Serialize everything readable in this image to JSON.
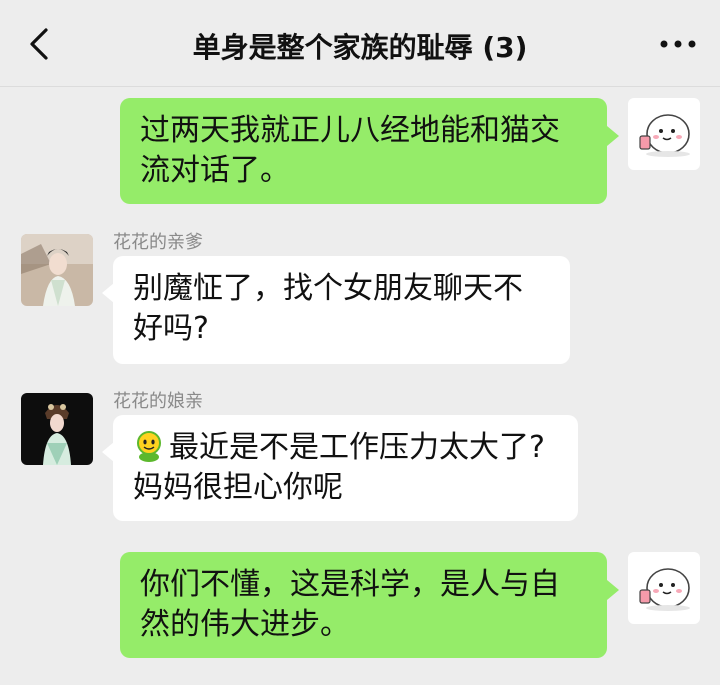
{
  "header": {
    "title": "单身是整个家族的耻辱 (3)",
    "back_icon": "chevron-left-icon",
    "more_icon": "more-dots-icon"
  },
  "messages": [
    {
      "side": "out",
      "sender": "",
      "avatar": "cartoon-bun-avatar",
      "text": "过两天我就正儿八经地能和猫交流对话了。"
    },
    {
      "side": "in",
      "sender": "花花的亲爹",
      "avatar": "opera-man-avatar",
      "text": "别魔怔了，找个女朋友聊天不好吗?"
    },
    {
      "side": "in",
      "sender": "花花的娘亲",
      "avatar": "opera-woman-avatar",
      "emoji": "smiley-emoji",
      "text": "最近是不是工作压力太大了?妈妈很担心你呢"
    },
    {
      "side": "out",
      "sender": "",
      "avatar": "cartoon-bun-avatar",
      "text": "你们不懂，这是科学，是人与自然的伟大进步。"
    }
  ],
  "colors": {
    "background": "#ededed",
    "outgoing_bubble": "#95ec69",
    "incoming_bubble": "#ffffff",
    "sender_name": "#8a8a8a"
  }
}
